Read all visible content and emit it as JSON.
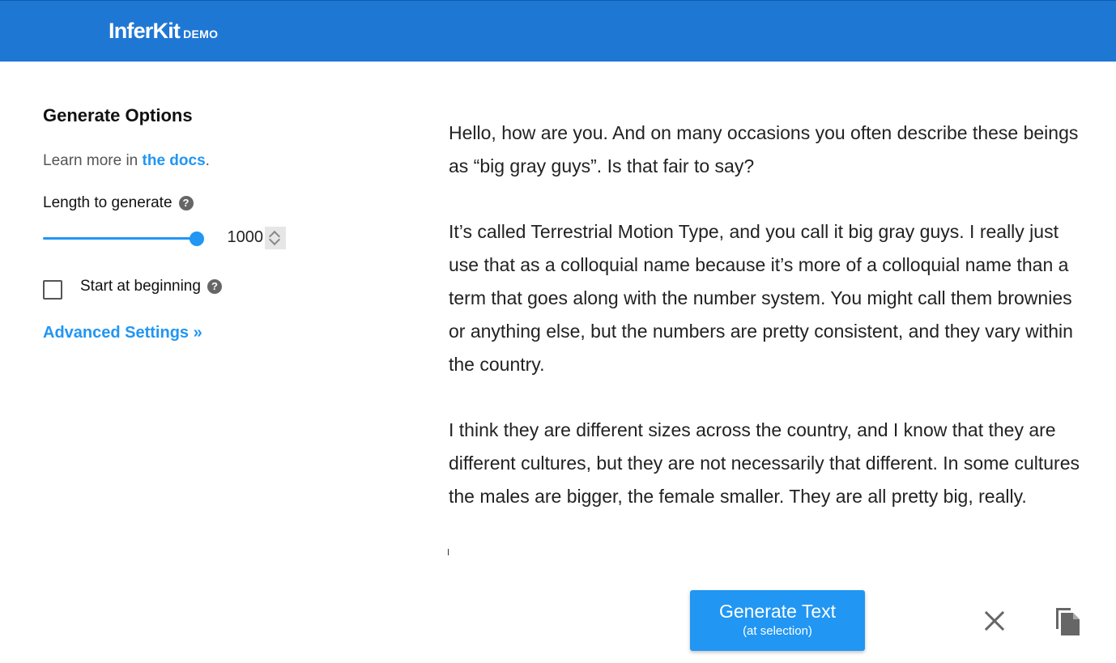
{
  "header": {
    "brand_name": "InferKit",
    "brand_tag": "DEMO"
  },
  "sidebar": {
    "title": "Generate Options",
    "learn_more_prefix": "Learn more in ",
    "docs_link": "the docs",
    "learn_more_suffix": ".",
    "length_label": "Length to generate",
    "length_value": "1000",
    "length_fraction": 1.0,
    "start_at_beginning_label": "Start at beginning",
    "start_at_beginning_checked": false,
    "advanced_settings": "Advanced Settings »",
    "help_glyph": "?"
  },
  "editor": {
    "paragraphs": [
      "Hello, how are you. And on many occasions you often describe these beings as “big gray guys”. Is that fair to say?",
      "It’s called Terrestrial Motion Type, and you call it big gray guys. I really just use that as a colloquial name because it’s more of a colloquial name than a term that goes along with the number system. You might call them brownies or anything else, but the numbers are pretty consistent, and they vary within the country.",
      "I think they are different sizes across the country, and I know that they are different cultures, but they are not necessarily that different. In some cultures the males are bigger, the female smaller. They are all pretty big, really."
    ]
  },
  "actions": {
    "generate_label": "Generate Text",
    "generate_sublabel": "(at selection)",
    "clear_icon": "close-icon",
    "copy_icon": "copy-icon"
  },
  "colors": {
    "header": "#1f77d4",
    "accent": "#2196f3"
  }
}
